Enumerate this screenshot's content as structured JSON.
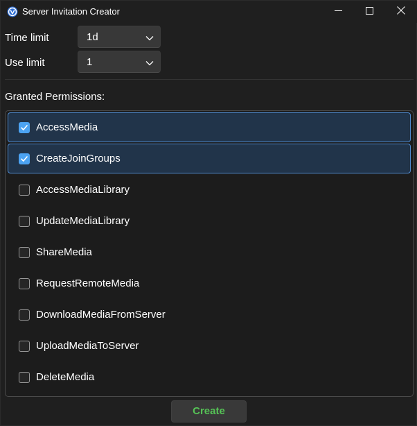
{
  "window": {
    "title": "Server Invitation Creator"
  },
  "form": {
    "time_limit": {
      "label": "Time limit",
      "value": "1d"
    },
    "use_limit": {
      "label": "Use limit",
      "value": "1"
    }
  },
  "permissions": {
    "label": "Granted Permissions:",
    "items": [
      {
        "label": "AccessMedia",
        "checked": true,
        "selected": true
      },
      {
        "label": "CreateJoinGroups",
        "checked": true,
        "selected": true
      },
      {
        "label": "AccessMediaLibrary",
        "checked": false,
        "selected": false
      },
      {
        "label": "UpdateMediaLibrary",
        "checked": false,
        "selected": false
      },
      {
        "label": "ShareMedia",
        "checked": false,
        "selected": false
      },
      {
        "label": "RequestRemoteMedia",
        "checked": false,
        "selected": false
      },
      {
        "label": "DownloadMediaFromServer",
        "checked": false,
        "selected": false
      },
      {
        "label": "UploadMediaToServer",
        "checked": false,
        "selected": false
      },
      {
        "label": "DeleteMedia",
        "checked": false,
        "selected": false
      }
    ]
  },
  "actions": {
    "create_label": "Create"
  },
  "colors": {
    "accent": "#4ca3f2",
    "selection_bg": "#21344a",
    "selection_border": "#4f8bd0",
    "create_text": "#56c356",
    "window_bg": "#1f1f1f"
  },
  "icons": {
    "app": "app-logo-icon",
    "minimize": "minimize-icon",
    "maximize": "maximize-icon",
    "close": "close-icon",
    "dropdown": "chevron-down-icon",
    "check": "checkmark-icon"
  }
}
